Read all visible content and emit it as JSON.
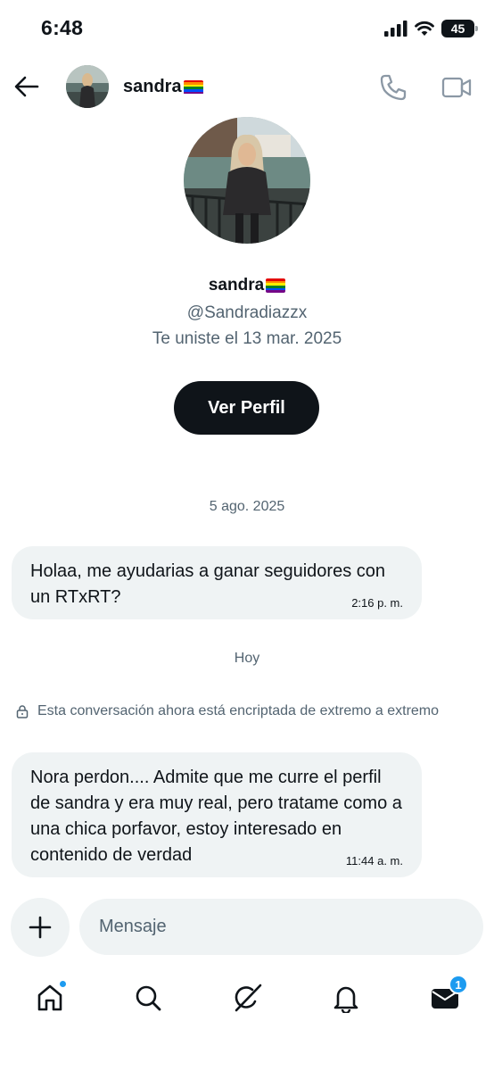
{
  "status_bar": {
    "time": "6:48",
    "battery": "45"
  },
  "header": {
    "name": "sandra"
  },
  "profile": {
    "name": "sandra",
    "handle": "@Sandradiazzx",
    "joined": "Te uniste el 13 mar. 2025",
    "view_profile_label": "Ver Perfil"
  },
  "conversation": {
    "date_1": "5 ago. 2025",
    "message_1": {
      "text": "Holaa, me ayudarias a ganar seguidores con un RTxRT?",
      "time": "2:16 p. m."
    },
    "date_2": "Hoy",
    "encryption_notice": "Esta conversación ahora está encriptada de extremo a extremo",
    "message_2": {
      "text": "Nora perdon.... Admite que me curre el perfil de sandra y era muy real, pero tratame como a una chica porfavor, estoy interesado en contenido de verdad",
      "time": "11:44 a. m."
    }
  },
  "composer": {
    "placeholder": "Mensaje"
  },
  "nav": {
    "messages_badge": "1"
  },
  "colors": {
    "accent": "#1d9bf0",
    "text": "#0f1419",
    "muted": "#536471",
    "bubble": "#eff3f4"
  },
  "icons": [
    "back-arrow-icon",
    "phone-icon",
    "video-camera-icon",
    "lock-icon",
    "plus-icon",
    "home-icon",
    "search-icon",
    "grok-icon",
    "bell-icon",
    "envelope-icon",
    "rainbow-flag-icon"
  ]
}
